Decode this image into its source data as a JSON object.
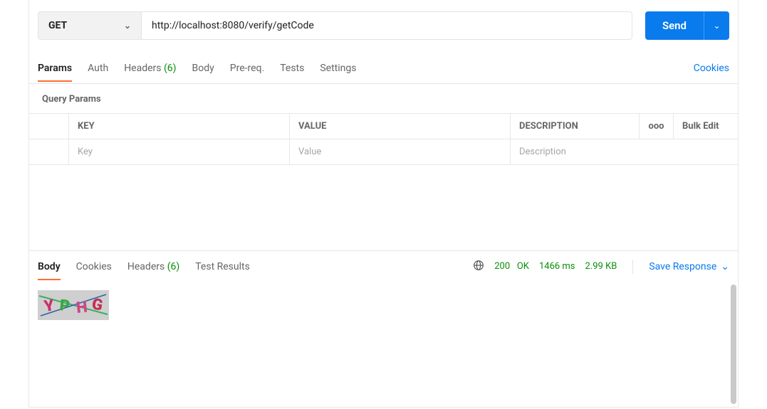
{
  "request": {
    "method": "GET",
    "url": "http://localhost:8080/verify/getCode",
    "send_label": "Send"
  },
  "tabs1": {
    "params": "Params",
    "auth": "Auth",
    "headers": "Headers",
    "headers_count": "(6)",
    "body": "Body",
    "prereq": "Pre-req.",
    "tests": "Tests",
    "settings": "Settings",
    "cookies_link": "Cookies"
  },
  "params_table": {
    "section_title": "Query Params",
    "headers": {
      "key": "KEY",
      "value": "VALUE",
      "description": "DESCRIPTION"
    },
    "bulk_edit": "Bulk Edit",
    "more_icon": "ooo",
    "placeholders": {
      "key": "Key",
      "value": "Value",
      "description": "Description"
    }
  },
  "response_tabs": {
    "body": "Body",
    "cookies": "Cookies",
    "headers": "Headers",
    "headers_count": "(6)",
    "test_results": "Test Results"
  },
  "response_meta": {
    "status_code": "200",
    "status_text": "OK",
    "time": "1466 ms",
    "size": "2.99 KB",
    "save_response": "Save Response"
  }
}
